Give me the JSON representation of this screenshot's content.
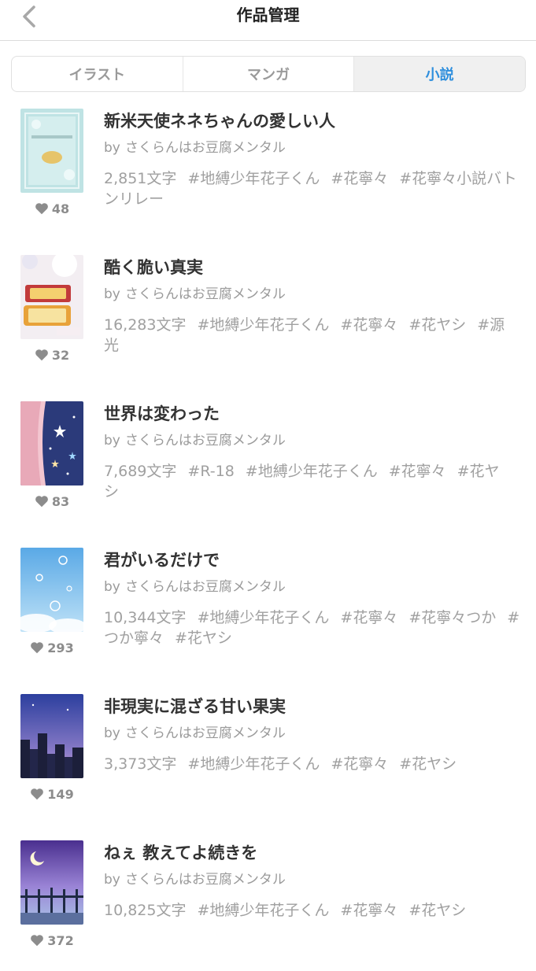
{
  "header": {
    "title": "作品管理",
    "back_icon": "chevron-left-icon"
  },
  "tabs": [
    {
      "label": "イラスト",
      "active": false
    },
    {
      "label": "マンガ",
      "active": false
    },
    {
      "label": "小説",
      "active": true
    }
  ],
  "colors": {
    "accent": "#2f8fdd",
    "muted": "#9a9a9a",
    "tab_active_bg": "#f0f0f0"
  },
  "works": [
    {
      "title": "新米天使ネネちゃんの愛しい人",
      "by": "by",
      "author": "さくらんはお豆腐メンタル",
      "chars": "2,851文字",
      "tags": [
        "#地縛少年花子くん",
        "#花寧々",
        "#花寧々小説バトンリレー"
      ],
      "likes": "48",
      "cover": "mint-frame-cover"
    },
    {
      "title": "酷く脆い真実",
      "by": "by",
      "author": "さくらんはお豆腐メンタル",
      "chars": "16,283文字",
      "tags": [
        "#地縛少年花子くん",
        "#花寧々",
        "#花ヤシ",
        "#源光"
      ],
      "likes": "32",
      "cover": "bento-cover"
    },
    {
      "title": "世界は変わった",
      "by": "by",
      "author": "さくらんはお豆腐メンタル",
      "chars": "7,689文字",
      "tags": [
        "#R-18",
        "#地縛少年花子くん",
        "#花寧々",
        "#花ヤシ"
      ],
      "likes": "83",
      "cover": "curtain-starry-cover"
    },
    {
      "title": "君がいるだけで",
      "by": "by",
      "author": "さくらんはお豆腐メンタル",
      "chars": "10,344文字",
      "tags": [
        "#地縛少年花子くん",
        "#花寧々",
        "#花寧々つか",
        "#つか寧々",
        "#花ヤシ"
      ],
      "likes": "293",
      "cover": "bubbles-sky-cover"
    },
    {
      "title": "非現実に混ざる甘い果実",
      "by": "by",
      "author": "さくらんはお豆腐メンタル",
      "chars": "3,373文字",
      "tags": [
        "#地縛少年花子くん",
        "#花寧々",
        "#花ヤシ"
      ],
      "likes": "149",
      "cover": "night-city-cover"
    },
    {
      "title": "ねぇ 教えてよ続きを",
      "by": "by",
      "author": "さくらんはお豆腐メンタル",
      "chars": "10,825文字",
      "tags": [
        "#地縛少年花子くん",
        "#花寧々",
        "#花ヤシ"
      ],
      "likes": "372",
      "cover": "moon-gate-cover"
    }
  ]
}
